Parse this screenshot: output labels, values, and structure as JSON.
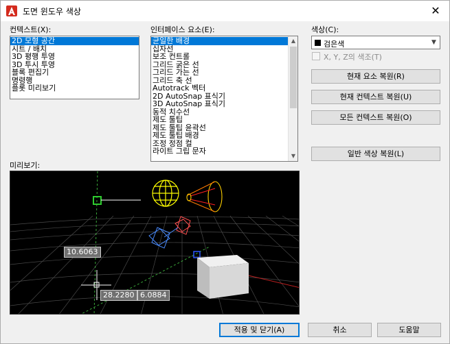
{
  "window": {
    "title": "도면 윈도우 색상",
    "close_glyph": "✕"
  },
  "context": {
    "label": "컨텍스트(X):",
    "items": [
      "2D 모형 공간",
      "시트 / 배치",
      "3D 평행 투영",
      "3D 투시 투영",
      "블록 편집기",
      "명령행",
      "플롯 미리보기"
    ],
    "selected_index": 0
  },
  "interface": {
    "label": "인터페이스 요소(E):",
    "items": [
      "균일한 배경",
      "십자선",
      "보조 컨트롤",
      "그리드 굵은 선",
      "그리드 가는 선",
      "그리드 축 선",
      "Autotrack 벡터",
      "2D AutoSnap 표식기",
      "3D AutoSnap 표식기",
      "동적 치수선",
      "제도 툴팁",
      "제도 툴팁 윤곽선",
      "제도 툴팁 배경",
      "조정 정점 컬",
      "라이트 그립 문자"
    ],
    "selected_index": 0
  },
  "color": {
    "label": "색상(C):",
    "value": "검은색",
    "swatch_color": "#000000",
    "xyz_checkbox_label": "X, Y, Z의 색조(T)",
    "xyz_checked": false
  },
  "buttons": {
    "restore_current_element": "현재 요소 복원(R)",
    "restore_current_context": "현재 컨텍스트 복원(U)",
    "restore_all_contexts": "모든 컨텍스트 복원(O)",
    "restore_classic_colors": "일반 색상 복원(L)",
    "apply_close": "적용 및 닫기(A)",
    "cancel": "취소",
    "help": "도움말"
  },
  "preview": {
    "label": "미리보기:",
    "dim_values": [
      "10.6063",
      "28.2280",
      "6.0884"
    ]
  },
  "colors": {
    "accent": "#0078d7",
    "preview_background": "#000000",
    "app_icon": "#d42b1e"
  }
}
